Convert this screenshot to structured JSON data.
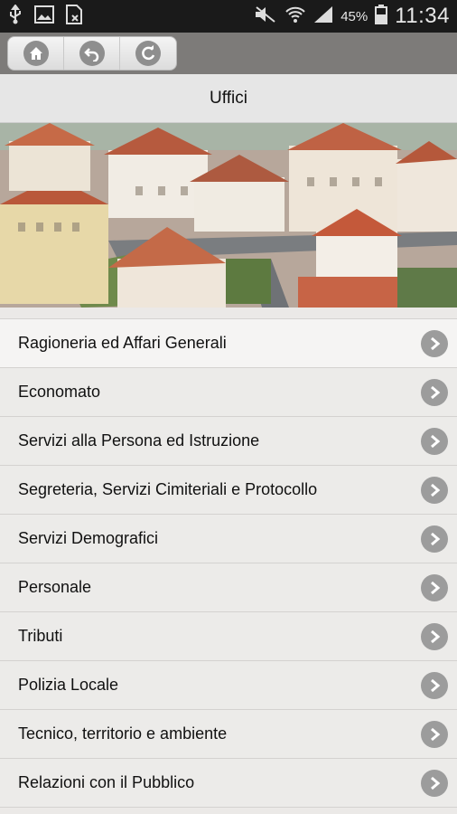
{
  "status_bar": {
    "battery_percent": "45%",
    "time": "11:34"
  },
  "toolbar": {
    "buttons": [
      {
        "name": "home",
        "icon": "home-icon"
      },
      {
        "name": "back",
        "icon": "undo-icon"
      },
      {
        "name": "refresh",
        "icon": "refresh-icon"
      }
    ]
  },
  "page": {
    "title": "Uffici"
  },
  "offices": [
    {
      "label": "Ragioneria ed Affari Generali"
    },
    {
      "label": "Economato"
    },
    {
      "label": "Servizi alla Persona ed Istruzione"
    },
    {
      "label": "Segreteria, Servizi Cimiteriali e Protocollo"
    },
    {
      "label": "Servizi Demografici"
    },
    {
      "label": "Personale"
    },
    {
      "label": "Tributi"
    },
    {
      "label": "Polizia Locale"
    },
    {
      "label": "Tecnico, territorio e ambiente"
    },
    {
      "label": "Relazioni con il Pubblico"
    }
  ]
}
